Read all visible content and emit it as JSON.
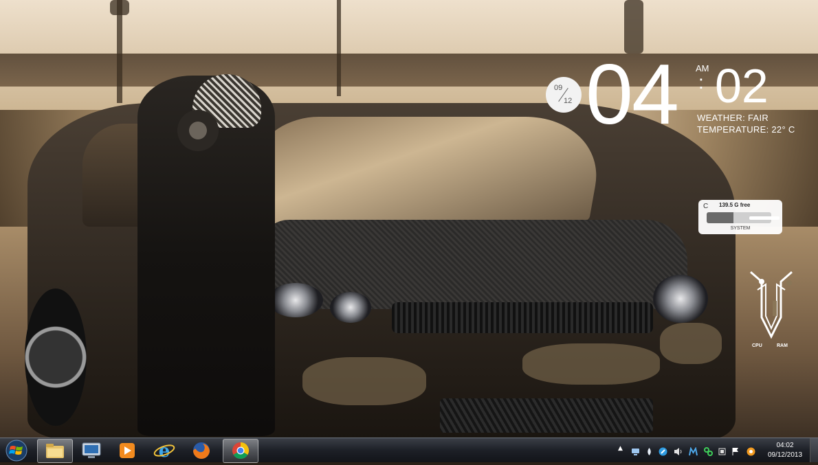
{
  "widgets": {
    "date": {
      "month": "09",
      "day": "12"
    },
    "clock": {
      "hour": "04",
      "minute": "02",
      "ampm": "AM",
      "colon": ":"
    },
    "weather": {
      "condition": "WEATHER: FAIR",
      "temperature": "TEMPERATURE: 22° C"
    },
    "drive": {
      "letter": "C",
      "free": "139.5 G free",
      "name": "SYSTEM",
      "used_fraction": 0.42
    },
    "meter": {
      "cpu_label": "CPU",
      "ram_label": "RAM"
    }
  },
  "taskbar": {
    "pinned": [
      {
        "name": "windows-explorer",
        "icon": "folder-icon",
        "active": true
      },
      {
        "name": "remote-desktop",
        "icon": "monitor-icon",
        "active": false
      },
      {
        "name": "media-player",
        "icon": "play-icon",
        "active": false
      },
      {
        "name": "internet-explorer",
        "icon": "ie-icon",
        "active": false
      },
      {
        "name": "firefox",
        "icon": "firefox-icon",
        "active": false
      },
      {
        "name": "chrome",
        "icon": "chrome-icon",
        "active": true
      }
    ],
    "tray": {
      "expand": "▲",
      "time": "04:02",
      "date": "09/12/2013"
    }
  },
  "colors": {
    "taskbar": "#1d2027",
    "widget_text": "#ffffff",
    "chrome_red": "#db4437",
    "chrome_yellow": "#f4c20d",
    "chrome_green": "#0f9d58",
    "chrome_blue": "#4285f4"
  }
}
